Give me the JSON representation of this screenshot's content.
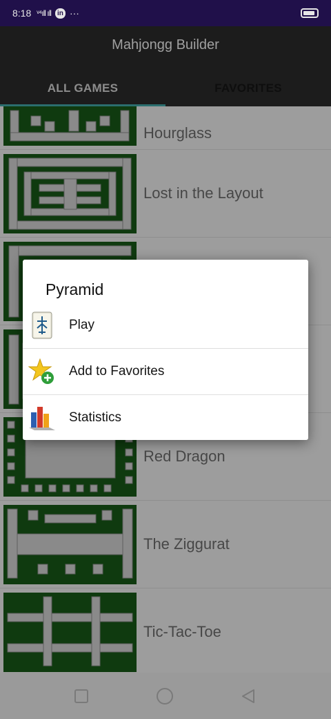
{
  "status_bar": {
    "time": "8:18",
    "signal": "ᵛ⁴ıll ıll",
    "linkedin": "in",
    "more": "···"
  },
  "app": {
    "title": "Mahjongg Builder",
    "tabs": [
      {
        "label": "ALL GAMES",
        "active": true
      },
      {
        "label": "FAVORITES",
        "active": false
      }
    ]
  },
  "layouts": [
    {
      "name": "Hourglass"
    },
    {
      "name": "Lost in the Layout"
    },
    {
      "name": ""
    },
    {
      "name": ""
    },
    {
      "name": "Red Dragon"
    },
    {
      "name": "The Ziggurat"
    },
    {
      "name": "Tic-Tac-Toe"
    }
  ],
  "dialog": {
    "title": "Pyramid",
    "items": [
      {
        "label": "Play",
        "icon": "mahjong-tile-icon"
      },
      {
        "label": "Add to Favorites",
        "icon": "star-add-icon"
      },
      {
        "label": "Statistics",
        "icon": "bar-chart-icon"
      }
    ]
  },
  "colors": {
    "status_bar": "#20104a",
    "app_bar": "#1c1c1c",
    "tab_indicator": "#2b6e6e",
    "board_green": "#0f3a0f",
    "dialog_bg": "#ffffff"
  }
}
